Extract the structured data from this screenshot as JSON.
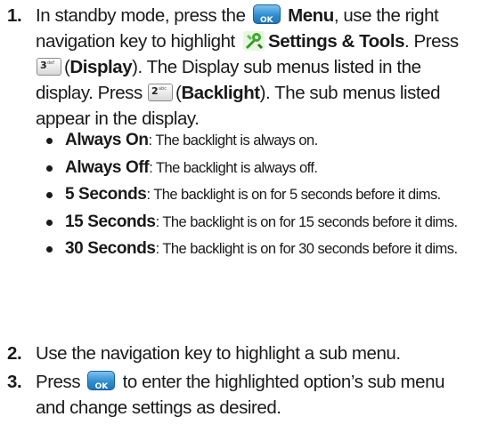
{
  "step1": {
    "num": "1.",
    "t1": "In standby mode, press the",
    "ok_key": "OK",
    "menu": "Menu",
    "t2": ", use the right navigation key to highlight",
    "settings": "Settings & Tools",
    "t3": ". Press",
    "key3_num": "3",
    "key3_sub": "def",
    "t4": "(",
    "display": "Display",
    "t5": "). The Display sub menus listed in the display. Press",
    "key2_num": "2",
    "key2_sub": "abc",
    "t6": "(",
    "backlight": "Backlight",
    "t7": "). The sub menus listed appear in the display."
  },
  "bullets": [
    {
      "term": "Always On",
      "desc": ": The backlight is always on."
    },
    {
      "term": "Always Off",
      "desc": ": The backlight is always off."
    },
    {
      "term": "5 Seconds",
      "desc": ": The backlight is on for 5 seconds before it dims."
    },
    {
      "term": "15 Seconds",
      "desc": ": The backlight is on for 15 seconds before it dims."
    },
    {
      "term": "30 Seconds",
      "desc": ": The backlight is on for 30 seconds before it dims."
    }
  ],
  "step2": {
    "num": "2.",
    "text": "Use the navigation key to highlight a sub menu."
  },
  "step3": {
    "num": "3.",
    "t1": "Press",
    "ok_key": "OK",
    "t2": "to enter the highlighted option’s sub menu and change settings as desired."
  },
  "icons": {
    "ok_key": "ok-key-icon",
    "settings_tools": "settings-tools-icon",
    "key3": "key-3-icon",
    "key2": "key-2-icon"
  },
  "colors": {
    "ok_key": "#2f8fd2",
    "tools_icon": "#3aa832"
  }
}
